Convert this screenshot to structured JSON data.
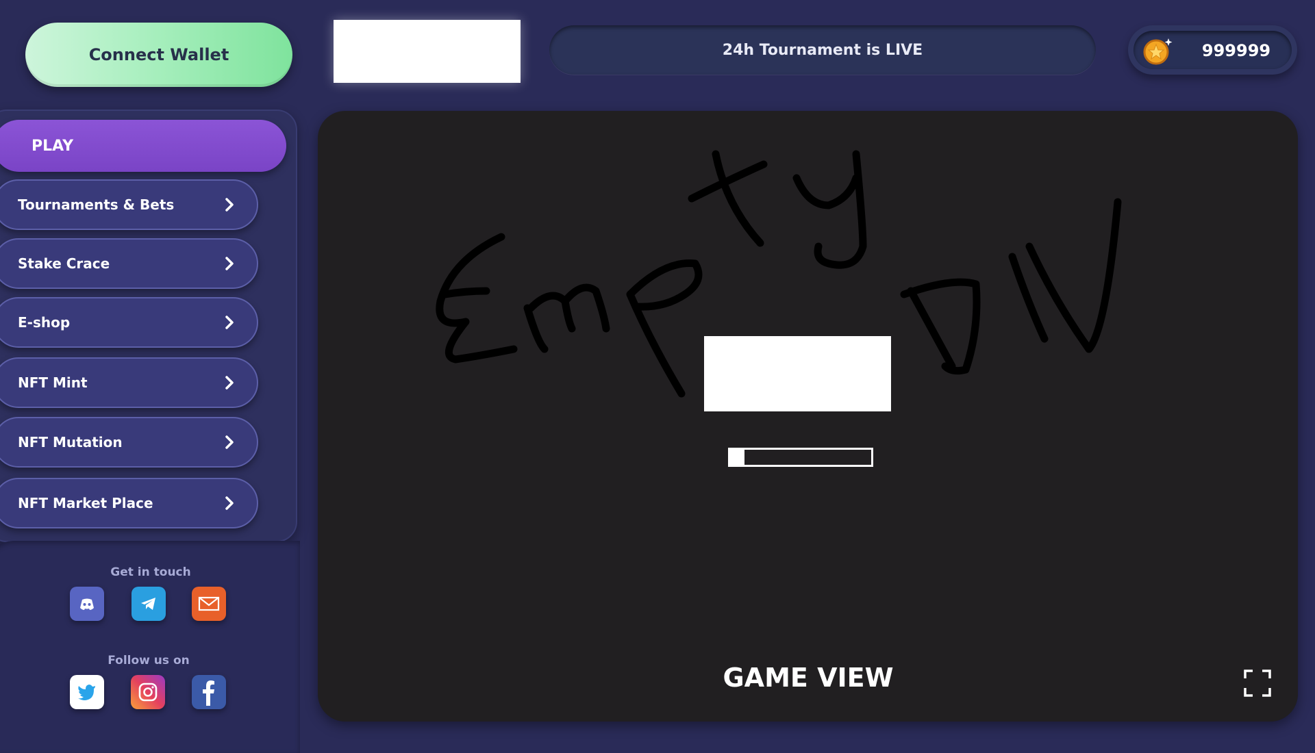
{
  "header": {
    "connect_wallet_label": "Connect Wallet",
    "tournament_banner": "24h Tournament is LIVE",
    "coin_balance": "999999"
  },
  "sidebar": {
    "play_label": "PLAY",
    "items": [
      {
        "label": "Tournaments & Bets"
      },
      {
        "label": "Stake Crace"
      },
      {
        "label": "E-shop"
      },
      {
        "label": "NFT Mint"
      },
      {
        "label": "NFT Mutation"
      },
      {
        "label": "NFT Market Place"
      }
    ]
  },
  "contact": {
    "get_in_touch_label": "Get in touch",
    "follow_label": "Follow us on",
    "contact_icons": [
      "discord-icon",
      "telegram-icon",
      "email-icon"
    ],
    "follow_icons": [
      "twitter-icon",
      "instagram-icon",
      "facebook-icon"
    ]
  },
  "game": {
    "label": "GAME VIEW",
    "loading_progress": 0.1
  },
  "colors": {
    "background": "#2a2b58",
    "play_active": "#7a44c6",
    "connect_button": "#a9efbf",
    "game_view": "#211f21"
  }
}
